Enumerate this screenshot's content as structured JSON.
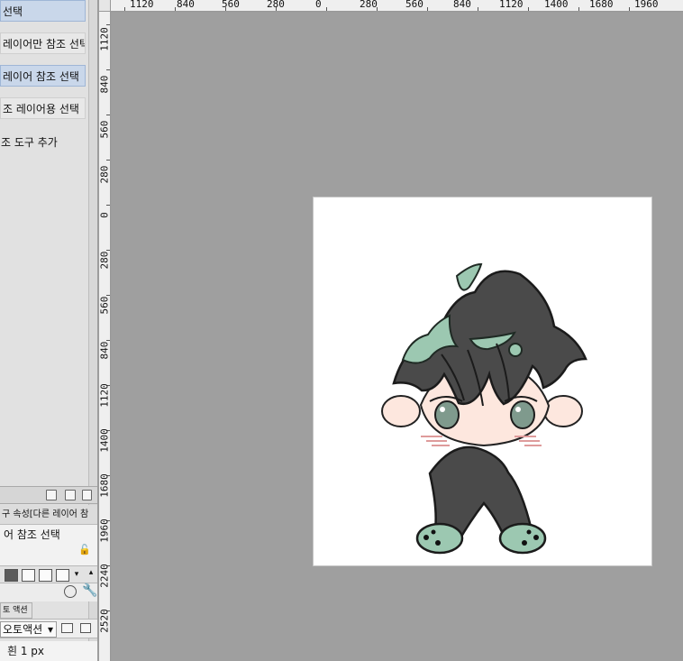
{
  "left_panel": {
    "menu_items": [
      {
        "label": "선택"
      },
      {
        "label": "레이어만 참조 선택"
      },
      {
        "label": "레이어 참조 선택"
      },
      {
        "label": "조 레이어용 선택"
      }
    ],
    "tool_add_label": "조 도구 추가",
    "property_header": "구 속성[다른 레이어 참",
    "property_value": "어 참조 선택",
    "autoaction_tab_label": "토 액션",
    "autoaction_select_value": "오토액션",
    "status_value": "흰 1 px"
  },
  "rulers": {
    "top_labels": [
      "1120",
      "840",
      "560",
      "280",
      "0",
      "280",
      "560",
      "840",
      "1120",
      "1400",
      "1680",
      "1960"
    ],
    "left_labels": [
      "1120",
      "840",
      "560",
      "280",
      "0",
      "280",
      "560",
      "840",
      "1120",
      "1400",
      "1680",
      "1960",
      "2240",
      "2520"
    ]
  },
  "icons": {
    "export": "export-icon",
    "new_layer": "new-layer-icon",
    "delete": "trash-icon",
    "lock": "lock-icon",
    "mode_square": "mode-square-icon",
    "folder": "folder-icon",
    "tool_dial": "dial-icon",
    "tool_wrench": "wrench-icon"
  },
  "colors": {
    "selection": "#c9d7ea",
    "canvas_bg": "#9f9f9f",
    "panel_bg": "#e1e1e1",
    "art_mint": "#9cc8b1",
    "art_dark": "#444444",
    "art_skin": "#fde7de"
  }
}
